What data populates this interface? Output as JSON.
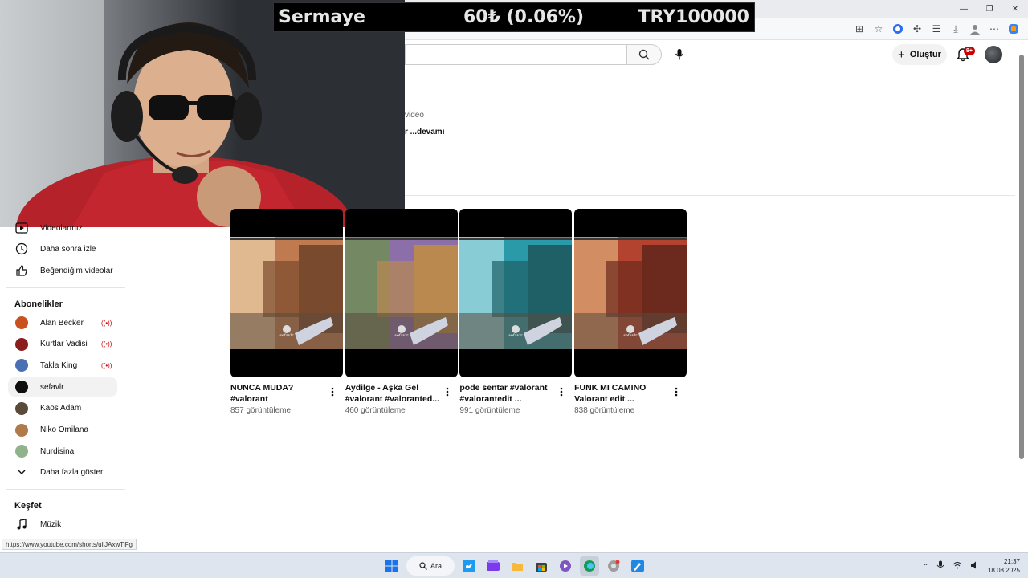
{
  "stream_overlay": {
    "label": "Sermaye",
    "change": "60₺ (0.06%)",
    "symbol": "TRY100000"
  },
  "header": {
    "create_label": "Oluştur",
    "notification_count": "9+"
  },
  "channel": {
    "meta_suffix": "video",
    "more_label": "r ...devamı"
  },
  "sidebar": {
    "items_top": [
      {
        "label": "Videolarınız",
        "icon": "play-icon"
      },
      {
        "label": "Daha sonra izle",
        "icon": "clock-icon"
      },
      {
        "label": "Beğendiğim videolar",
        "icon": "thumbs-up-icon"
      }
    ],
    "subscriptions_title": "Abonelikler",
    "subscriptions": [
      {
        "name": "Alan Becker",
        "live": true,
        "color": "#c9501f"
      },
      {
        "name": "Kurtlar Vadisi",
        "live": true,
        "color": "#8b1d1d"
      },
      {
        "name": "Takla King",
        "live": true,
        "color": "#4b6fb5"
      },
      {
        "name": "sefavlr",
        "live": false,
        "color": "#0f0f0f"
      },
      {
        "name": "Kaos Adam",
        "live": false,
        "color": "#5a4a3a"
      },
      {
        "name": "Niko Omilana",
        "live": false,
        "color": "#b07a4a"
      },
      {
        "name": "Nurdisina",
        "live": false,
        "color": "#8fb38a"
      }
    ],
    "show_more_label": "Daha fazla göster",
    "explore_title": "Keşfet",
    "explore_items": [
      {
        "label": "Müzik",
        "icon": "music-note-icon"
      }
    ]
  },
  "shorts": [
    {
      "title": "NUNCA MUDA? #valorant #valorantedi...",
      "views": "857 görüntüleme",
      "overlay": "sefavlr"
    },
    {
      "title": "Aydilge - Aşka Gel #valorant  #valoranted...",
      "views": "460 görüntüleme",
      "overlay": "sefavlr"
    },
    {
      "title": "pode sentar #valorant #valorantedit ...",
      "views": "991 görüntüleme",
      "overlay": "sefavlr"
    },
    {
      "title": "FUNK MI CAMINO Valorant edit ...",
      "views": "838 görüntüleme",
      "overlay": "sefavlr"
    }
  ],
  "status_url": "https://www.youtube.com/shorts/ullJAxwTiFg",
  "taskbar": {
    "search_label": "Ara",
    "time": "21:37",
    "date": "18.08.2025"
  },
  "colors": {
    "live": "#cc0000",
    "badge": "#cc0000",
    "ticker_bg": "#000000"
  }
}
